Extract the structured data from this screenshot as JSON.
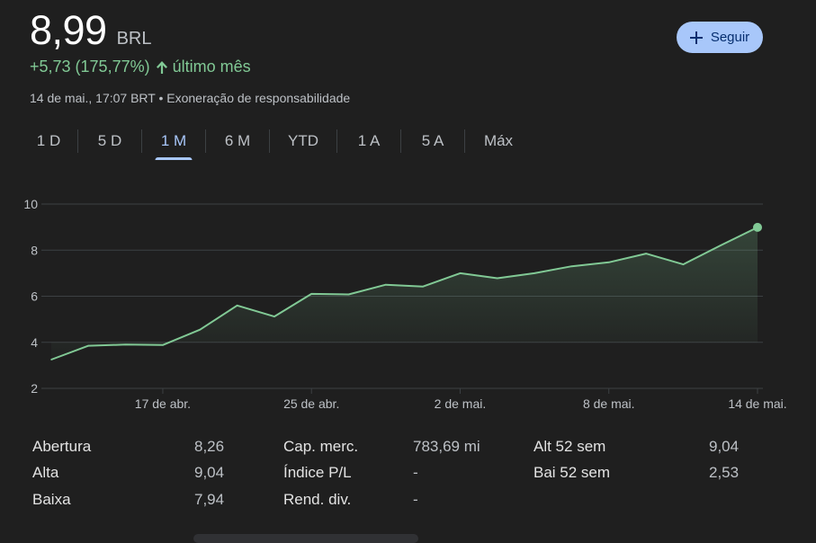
{
  "quote": {
    "price": "8,99",
    "currency": "BRL",
    "change": "+5,73 (175,77%)",
    "period": "último mês",
    "timestamp": "14 de mai., 17:07 BRT",
    "separator": "•",
    "disclaimer": "Exoneração de responsabilidade"
  },
  "follow_button": {
    "label": "Seguir"
  },
  "tabs": [
    {
      "label": "1 D",
      "active": false
    },
    {
      "label": "5 D",
      "active": false
    },
    {
      "label": "1 M",
      "active": true
    },
    {
      "label": "6 M",
      "active": false
    },
    {
      "label": "YTD",
      "active": false
    },
    {
      "label": "1 A",
      "active": false
    },
    {
      "label": "5 A",
      "active": false
    },
    {
      "label": "Máx",
      "active": false
    }
  ],
  "colors": {
    "line": "#81c995",
    "accent": "#a8c7fa",
    "background": "#1f1f1f",
    "grid": "#3c4043"
  },
  "chart_data": {
    "type": "area",
    "ylim": [
      2,
      10
    ],
    "yticks": [
      2,
      4,
      6,
      8,
      10
    ],
    "ytick_labels": [
      "2",
      "4",
      "6",
      "8",
      "10"
    ],
    "x_start": "12 de abr.",
    "x_end": "14 de mai.",
    "xtick_labels": [
      "17 de abr.",
      "25 de abr.",
      "2 de mai.",
      "8 de mai.",
      "14 de mai."
    ],
    "xtick_index": [
      3,
      7,
      11,
      15,
      19
    ],
    "series": [
      {
        "values": [
          3.25,
          3.85,
          3.9,
          3.88,
          4.55,
          5.6,
          5.12,
          6.1,
          6.08,
          6.5,
          6.42,
          7.0,
          6.78,
          7.0,
          7.3,
          7.47,
          7.85,
          7.38,
          8.2,
          8.99
        ]
      }
    ],
    "grid": true,
    "last_point_marker": true
  },
  "stats": [
    {
      "label": "Abertura",
      "value": "8,26"
    },
    {
      "label": "Alta",
      "value": "9,04"
    },
    {
      "label": "Baixa",
      "value": "7,94"
    },
    {
      "label": "Cap. merc.",
      "value": "783,69 mi"
    },
    {
      "label": "Índice P/L",
      "value": "-"
    },
    {
      "label": "Rend. div.",
      "value": "-"
    },
    {
      "label": "Alt 52 sem",
      "value": "9,04"
    },
    {
      "label": "Bai 52 sem",
      "value": "2,53"
    }
  ]
}
